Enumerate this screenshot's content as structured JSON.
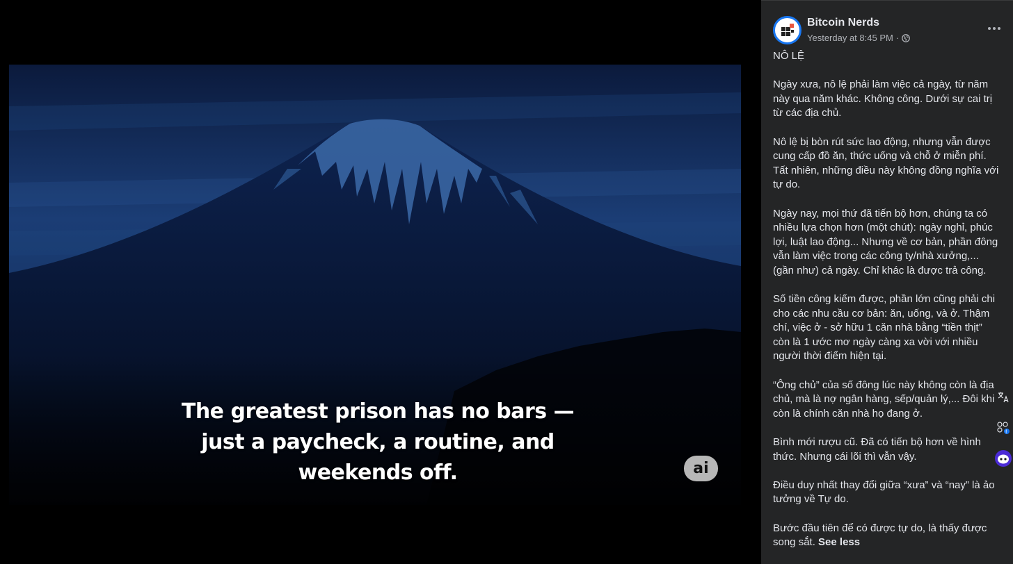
{
  "photo": {
    "caption_lines": [
      "The greatest prison has no bars —",
      "just a paycheck, a routine, and",
      "weekends off."
    ],
    "ai_badge": "ai"
  },
  "post": {
    "page_name": "Bitcoin Nerds",
    "timestamp": "Yesterday at 8:45 PM",
    "separator": "·",
    "audience_icon": "globe-icon",
    "paragraphs": [
      "NÔ LỆ",
      "Ngày xưa, nô lệ phải làm việc cả ngày, từ năm\nnày qua năm khác. Không công. Dưới sự cai trị\ntừ các địa chủ.",
      "Nô lệ bị bòn rút sức lao động, nhưng vẫn được\ncung cấp đồ ăn, thức uống và chỗ ở miễn phí.\nTất nhiên, những điều này không đồng nghĩa với\ntự do.",
      "Ngày nay, mọi thứ đã tiến bộ hơn, chúng ta có\nnhiều lựa chọn hơn (một chút): ngày nghỉ, phúc\nlợi, luật lao động... Nhưng về cơ bản, phần đông\nvẫn làm việc trong các công ty/nhà xưởng,...\n(gần như) cả ngày. Chỉ khác là được trả công.",
      "Số tiền công kiếm được, phần lớn cũng phải chi\ncho các nhu cầu cơ bản: ăn, uống, và ở. Thậm\nchí, việc ở - sở hữu 1 căn nhà bằng “tiền thịt”\ncòn là 1 ước mơ ngày càng xa vời với nhiều\nngười thời điểm hiện tại.",
      "“Ông chủ” của số đông lúc này không còn là địa\nchủ, mà là nợ ngân hàng, sếp/quản lý,... Đôi khi\ncòn là chính căn nhà họ đang ở.",
      "Bình mới rượu cũ. Đã có tiến bộ hơn về hình\nthức. Nhưng cái lõi thì vẫn vậy.",
      "Điều duy nhất thay đổi giữa “xưa” và “nay” là ảo\ntưởng về Tự do."
    ],
    "last_paragraph": "Bước đầu tiên để có được tự do, là thấy được\nsong sắt. ",
    "see_less": "See less"
  },
  "colors": {
    "sidebar_bg": "#242526",
    "text_primary": "#e4e6eb",
    "text_secondary": "#b0b3b8",
    "avatar_ring": "#1877f2",
    "logo_accent": "#e8553d"
  }
}
